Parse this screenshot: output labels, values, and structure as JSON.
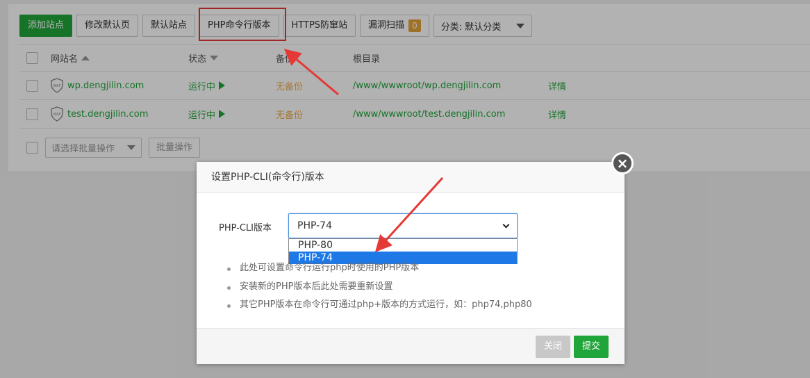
{
  "toolbar": {
    "add_site": "添加站点",
    "edit_default_page": "修改默认页",
    "default_site": "默认站点",
    "php_cli_version": "PHP命令行版本",
    "https_guard": "HTTPS防窜站",
    "vuln_scan": "漏洞扫描",
    "vuln_count": "0",
    "category_select": "分类: 默认分类"
  },
  "table": {
    "headers": {
      "site_name": "网站名",
      "status": "状态",
      "backup": "备份",
      "root_dir": "根目录"
    },
    "rows": [
      {
        "name": "wp.dengjilin.com",
        "status": "运行中",
        "backup": "无备份",
        "root": "/www/wwwroot/wp.dengjilin.com",
        "action": "详情"
      },
      {
        "name": "test.dengjilin.com",
        "status": "运行中",
        "backup": "无备份",
        "root": "/www/wwwroot/test.dengjilin.com",
        "action": "详情"
      }
    ]
  },
  "bulk": {
    "select_placeholder": "请选择批量操作",
    "button": "批量操作"
  },
  "dialog": {
    "title": "设置PHP-CLI(命令行)版本",
    "label": "PHP-CLI版本",
    "selected": "PHP-74",
    "options": [
      "PHP-80",
      "PHP-74"
    ],
    "notes": [
      "此处可设置命令行运行php时使用的PHP版本",
      "安装新的PHP版本后此处需要重新设置",
      "其它PHP版本在命令行可通过php+版本的方式运行，如：php74,php80"
    ],
    "close_label": "关闭",
    "submit_label": "提交"
  },
  "colors": {
    "accent_green": "#20a53a",
    "annotation_red": "#e53935",
    "backup_orange": "#f0ad4e",
    "selected_blue": "#1e79e6"
  }
}
